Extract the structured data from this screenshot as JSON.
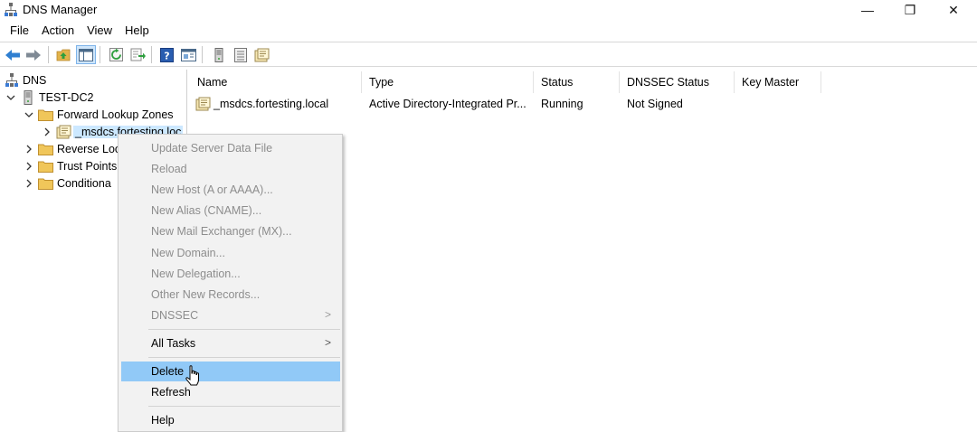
{
  "window": {
    "title": "DNS Manager",
    "controls": {
      "minimize": "—",
      "maximize": "❐",
      "close": "✕"
    }
  },
  "menubar": [
    "File",
    "Action",
    "View",
    "Help"
  ],
  "toolbar": {
    "icons": [
      "back-arrow-icon",
      "forward-arrow-icon",
      "up-folder-icon",
      "show-hide-tree-icon",
      "refresh-icon",
      "export-list-icon",
      "help-icon",
      "properties-panel-icon",
      "server-icon",
      "list-view-icon",
      "zone-icon"
    ]
  },
  "tree": {
    "root": "DNS",
    "server": "TEST-DC2",
    "forward_zones": "Forward Lookup Zones",
    "selected_zone": "_msdcs.fortesting.loc",
    "reverse_zones": "Reverse Loo",
    "trust_points": "Trust Points",
    "conditional": "Conditiona"
  },
  "list": {
    "columns": [
      "Name",
      "Type",
      "Status",
      "DNSSEC Status",
      "Key Master"
    ],
    "rows": [
      {
        "name": "_msdcs.fortesting.local",
        "type": "Active Directory-Integrated Pr...",
        "status": "Running",
        "dnssec": "Not Signed",
        "key_master": ""
      }
    ]
  },
  "context_menu": {
    "items": [
      {
        "label": "Update Server Data File",
        "enabled": false
      },
      {
        "label": "Reload",
        "enabled": false
      },
      {
        "label": "New Host (A or AAAA)...",
        "enabled": false
      },
      {
        "label": "New Alias (CNAME)...",
        "enabled": false
      },
      {
        "label": "New Mail Exchanger (MX)...",
        "enabled": false
      },
      {
        "label": "New Domain...",
        "enabled": false
      },
      {
        "label": "New Delegation...",
        "enabled": false
      },
      {
        "label": "Other New Records...",
        "enabled": false
      },
      {
        "label": "DNSSEC",
        "enabled": false,
        "submenu": true
      },
      {
        "label": "All Tasks",
        "enabled": true,
        "submenu": true
      },
      {
        "label": "Delete",
        "enabled": true,
        "highlighted": true
      },
      {
        "label": "Refresh",
        "enabled": true
      },
      {
        "label": "Help",
        "enabled": true
      }
    ],
    "submenu_arrow": ">"
  },
  "colors": {
    "highlight": "#91c9f7",
    "selection": "#cce8ff",
    "menu_bg": "#f2f2f2",
    "disabled_text": "#8d8d8d"
  }
}
